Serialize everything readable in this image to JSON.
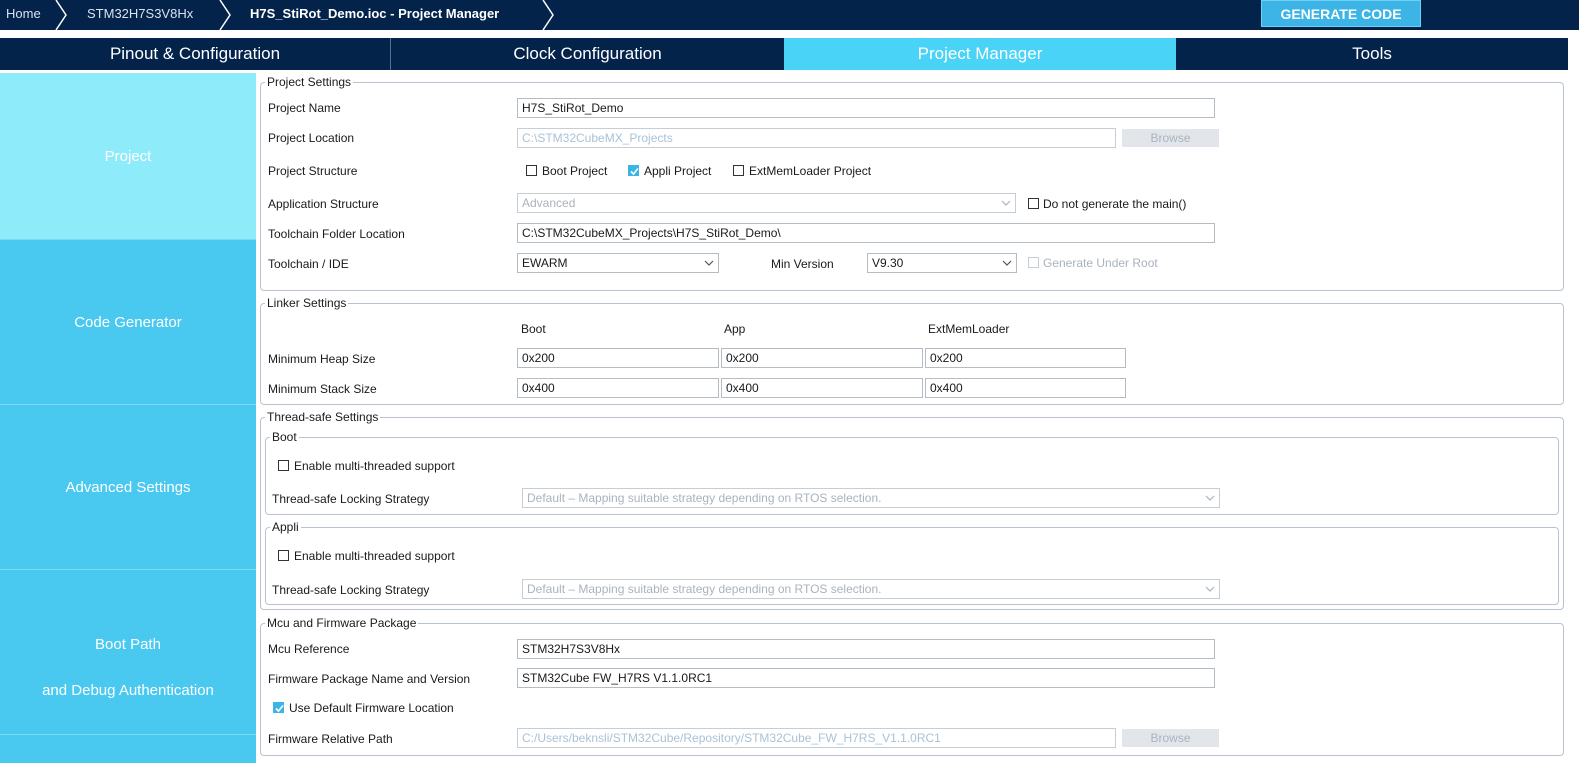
{
  "breadcrumb": {
    "home": "Home",
    "mcu": "STM32H7S3V8Hx",
    "project": "H7S_StiRot_Demo.ioc - Project Manager"
  },
  "generate_code_label": "GENERATE CODE",
  "tabs": [
    {
      "label": "Pinout & Configuration"
    },
    {
      "label": "Clock Configuration"
    },
    {
      "label": "Project Manager"
    },
    {
      "label": "Tools"
    }
  ],
  "sidebar": {
    "project": "Project",
    "code_generator": "Code Generator",
    "advanced_settings": "Advanced Settings",
    "boot_path_line1": "Boot Path",
    "boot_path_line2": "and Debug Authentication"
  },
  "project_settings": {
    "legend": "Project Settings",
    "name_label": "Project Name",
    "name_value": "H7S_StiRot_Demo",
    "location_label": "Project Location",
    "location_value": "C:\\STM32CubeMX_Projects",
    "browse_label": "Browse",
    "structure_label": "Project Structure",
    "boot_project": "Boot Project",
    "appli_project": "Appli Project",
    "extmem_project": "ExtMemLoader Project",
    "app_structure_label": "Application Structure",
    "app_structure_value": "Advanced",
    "no_main_label": "Do not generate the main()",
    "toolchain_folder_label": "Toolchain Folder Location",
    "toolchain_folder_value": "C:\\STM32CubeMX_Projects\\H7S_StiRot_Demo\\",
    "toolchain_label": "Toolchain / IDE",
    "toolchain_value": "EWARM",
    "min_version_label": "Min Version",
    "min_version_value": "V9.30",
    "generate_under_root": "Generate Under Root"
  },
  "linker_settings": {
    "legend": "Linker Settings",
    "col_boot": "Boot",
    "col_app": "App",
    "col_extmem": "ExtMemLoader",
    "heap_label": "Minimum Heap Size",
    "stack_label": "Minimum Stack Size",
    "heap_boot": "0x200",
    "heap_app": "0x200",
    "heap_extmem": "0x200",
    "stack_boot": "0x400",
    "stack_app": "0x400",
    "stack_extmem": "0x400"
  },
  "thread_safe": {
    "legend": "Thread-safe Settings",
    "boot_legend": "Boot",
    "appli_legend": "Appli",
    "enable_label": "Enable multi-threaded support",
    "strategy_label": "Thread-safe Locking Strategy",
    "strategy_value": "Default – Mapping suitable strategy depending on RTOS selection."
  },
  "mcu_fw": {
    "legend": "Mcu and Firmware Package",
    "mcu_ref_label": "Mcu Reference",
    "mcu_ref_value": "STM32H7S3V8Hx",
    "fw_name_label": "Firmware Package Name and Version",
    "fw_name_value": "STM32Cube FW_H7RS V1.1.0RC1",
    "use_default_label": "Use Default Firmware Location",
    "fw_path_label": "Firmware Relative Path",
    "fw_path_value": "C:/Users/beknsli/STM32Cube/Repository/STM32Cube_FW_H7RS_V1.1.0RC1",
    "browse_label": "Browse"
  },
  "colors": {
    "navy": "#03234b",
    "accent": "#3cb4e6",
    "tab_active": "#49d3f7",
    "sidebar": "#49c9f0",
    "sidebar_active": "#8eebfa"
  }
}
